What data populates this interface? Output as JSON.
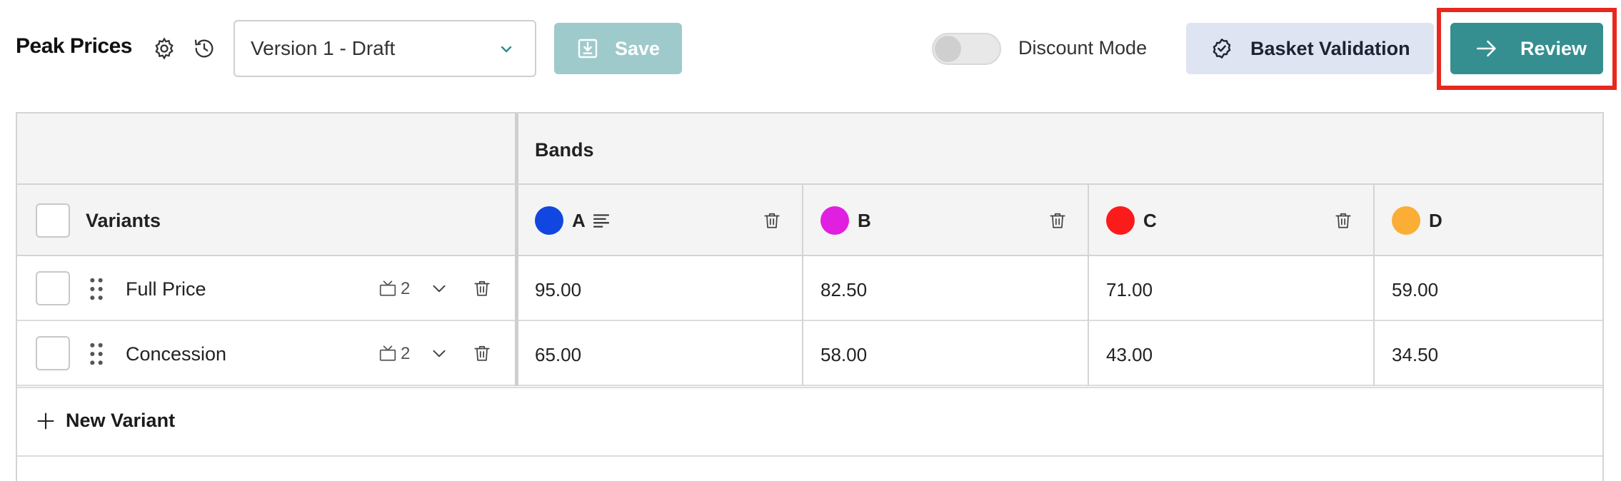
{
  "header": {
    "title": "Peak Prices",
    "version_select": {
      "value": "Version 1 - Draft"
    },
    "save_label": "Save",
    "discount_mode": {
      "label": "Discount Mode",
      "on": false
    },
    "basket_validation_label": "Basket Validation",
    "review_label": "Review"
  },
  "grid": {
    "bands_header": "Bands",
    "variants_header": "Variants",
    "bands": [
      {
        "letter": "A",
        "color": "#1147e0"
      },
      {
        "letter": "B",
        "color": "#e01fe0"
      },
      {
        "letter": "C",
        "color": "#fb1b1b"
      },
      {
        "letter": "D",
        "color": "#fbae35"
      }
    ],
    "variants": [
      {
        "name": "Full Price",
        "channel_count": "2",
        "prices": [
          "95.00",
          "82.50",
          "71.00",
          "59.00"
        ]
      },
      {
        "name": "Concession",
        "channel_count": "2",
        "prices": [
          "65.00",
          "58.00",
          "43.00",
          "34.50"
        ]
      }
    ],
    "new_variant_label": "New Variant"
  },
  "colors": {
    "accent": "#358f91",
    "save_disabled": "#9fcacc",
    "highlight": "#e8281e",
    "secondary_button": "#dfe4f2"
  }
}
